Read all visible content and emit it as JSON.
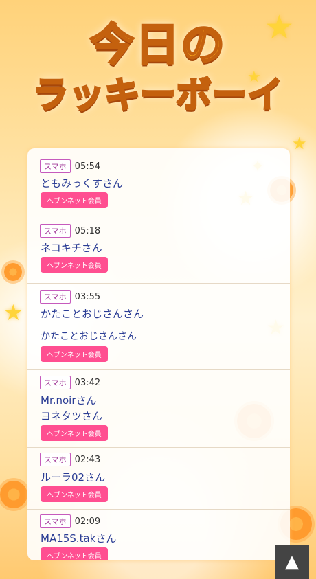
{
  "title": {
    "line1": "今日の",
    "line2": "ラッキーボーイ"
  },
  "entries": [
    {
      "device": "スマホ",
      "time": "05:54",
      "names": [
        "ともみっくすさん"
      ],
      "member": "ヘブンネット会員"
    },
    {
      "device": "スマホ",
      "time": "05:18",
      "names": [
        "ネコキチさん"
      ],
      "member": "ヘブンネット会員"
    },
    {
      "device": "スマホ",
      "time": "03:55",
      "names": [
        "かたことおじさんさん",
        "かたことおじさんさん"
      ],
      "member": "ヘブンネット会員"
    },
    {
      "device": "スマホ",
      "time": "03:42",
      "names": [
        "Mr.noirさん",
        "ヨネタツさん"
      ],
      "member": "ヘブンネット会員"
    },
    {
      "device": "スマホ",
      "time": "02:43",
      "names": [
        "ルーラ02さん"
      ],
      "member": "ヘブンネット会員"
    },
    {
      "device": "スマホ",
      "time": "02:09",
      "names": [
        "MA15S.takさん"
      ],
      "member": "ヘブンネット会員"
    }
  ],
  "scroll_top": {
    "icon": "up-triangle-icon",
    "glyph": "▲"
  },
  "colors": {
    "badge_border": "#c65bbd",
    "member_bg": "#ff4f91",
    "name": "#2a3c94"
  }
}
